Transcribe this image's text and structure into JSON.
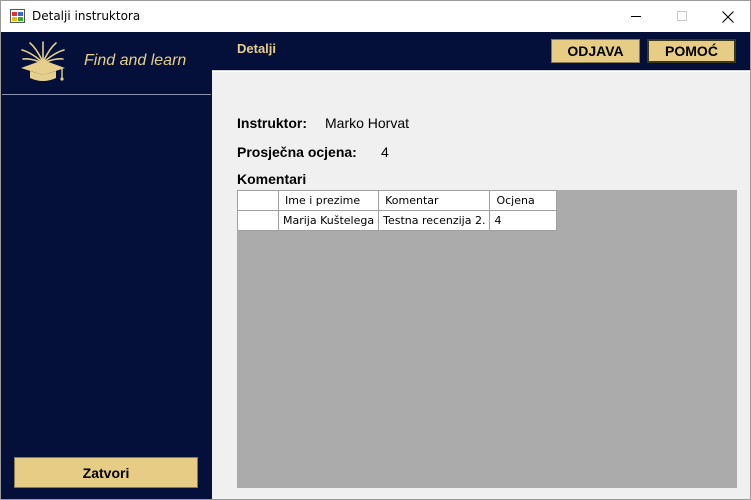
{
  "window": {
    "title": "Detalji instruktora",
    "controls": {
      "minimize": "minimize-icon",
      "maximize": "maximize-icon",
      "close": "close-icon"
    }
  },
  "sidebar": {
    "logo_text": "Find and learn",
    "logo_icon": "graduation-cap-icon",
    "close_button": "Zatvori"
  },
  "header": {
    "title": "Detalji",
    "logout_button": "ODJAVA",
    "help_button": "POMOĆ"
  },
  "details": {
    "instructor_label": "Instruktor:",
    "instructor_value": "Marko Horvat",
    "rating_label": "Prosječna ocjena:",
    "rating_value": "4",
    "comments_label": "Komentari"
  },
  "comments_table": {
    "columns": [
      "",
      "Ime i prezime",
      "Komentar",
      "Ocjena"
    ],
    "rows": [
      [
        "",
        "Marija Kuštelega",
        "Testna recenzija 2.",
        "4"
      ]
    ]
  },
  "colors": {
    "navy": "#04103a",
    "gold": "#e6cc84",
    "gold_text": "#e6cf8b",
    "grid_background": "#ababab"
  }
}
